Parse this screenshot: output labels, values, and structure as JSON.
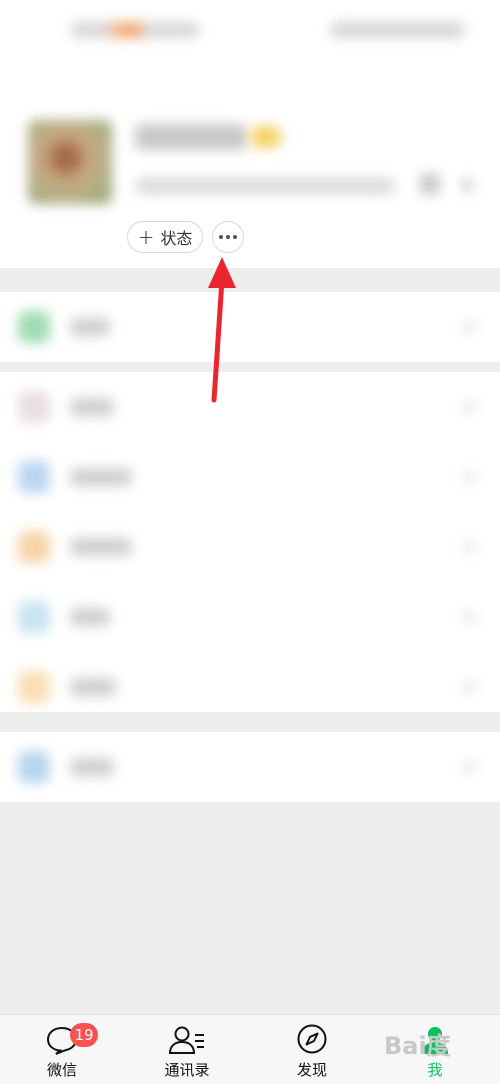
{
  "profile": {
    "status_button_label": "状态",
    "more_button": "more-options"
  },
  "tabbar": {
    "tabs": [
      {
        "label": "微信",
        "icon": "chat-bubble-icon",
        "badge": "19"
      },
      {
        "label": "通讯录",
        "icon": "contacts-icon"
      },
      {
        "label": "发现",
        "icon": "compass-icon"
      },
      {
        "label": "我",
        "icon": "person-icon",
        "active": true
      }
    ]
  },
  "watermark": {
    "text": "Bai度"
  },
  "colors": {
    "accent_green": "#07c160",
    "badge_red": "#fa5151",
    "arrow_red": "#e8262b"
  }
}
